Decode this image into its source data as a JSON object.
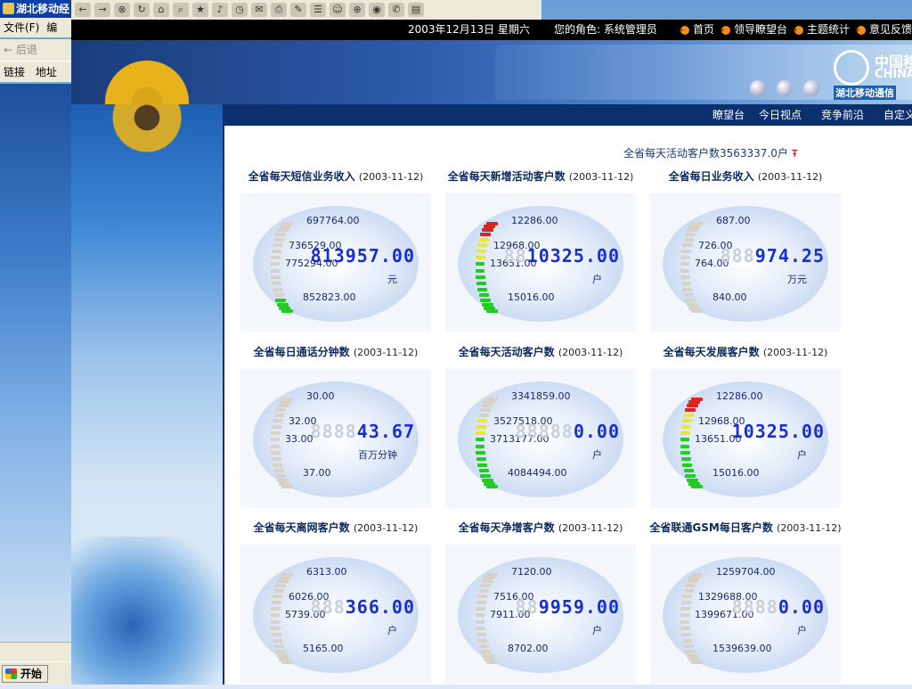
{
  "window": {
    "title": "湖北移动经",
    "menu": [
      "文件(F)",
      "编"
    ],
    "back_label": "后退",
    "links_label": "链接",
    "address_label": "地址",
    "start_label": "开始"
  },
  "banner": {
    "date": "2003年12月13日  星期六",
    "role": "您的角色: 系统管理员",
    "nav": [
      "首页",
      "领导瞭望台",
      "主题统计",
      "意见反馈"
    ],
    "logo_cn": "中国移",
    "logo_en": "CHINA",
    "logo_sub": "湖北移动通信"
  },
  "content": {
    "nav": [
      "瞭望台",
      "今日视点",
      "竞争前沿",
      "自定义"
    ],
    "active_count": "全省每天活动客户数3563337.0户"
  },
  "panels": [
    {
      "title": "全省每天短信业务收入",
      "date": "(2003-11-12)",
      "labels": [
        "697764.00",
        "736529.00",
        "775294.00",
        "852823.00"
      ],
      "value": "813957.00",
      "ghost": "",
      "unit": "元",
      "color_level": "green"
    },
    {
      "title": "全省每天新增活动客户数",
      "date": "(2003-11-12)",
      "labels": [
        "12286.00",
        "12968.00",
        "13651.00",
        "15016.00"
      ],
      "value": "10325.00",
      "ghost": "88",
      "unit": "户",
      "color_level": "full"
    },
    {
      "title": "全省每日业务收入",
      "date": "(2003-11-12)",
      "labels": [
        "687.00",
        "726.00",
        "764.00",
        "840.00"
      ],
      "value": "974.25",
      "ghost": "888",
      "unit": "万元",
      "color_level": "none"
    },
    {
      "title": "全省每日通话分钟数",
      "date": "(2003-11-12)",
      "labels": [
        "30.00",
        "32.00",
        "33.00",
        "37.00"
      ],
      "value": "43.67",
      "ghost": "8888",
      "unit": "百万分钟",
      "color_level": "none"
    },
    {
      "title": "全省每天活动客户数",
      "date": "(2003-11-12)",
      "labels": [
        "3341859.00",
        "3527518.00",
        "3713177.00",
        "4084494.00"
      ],
      "value": "0.00",
      "ghost": "88888",
      "unit": "户",
      "color_level": "yellow"
    },
    {
      "title": "全省每天发展客户数",
      "date": "(2003-11-12)",
      "labels": [
        "12286.00",
        "12968.00",
        "13651.00",
        "15016.00"
      ],
      "value": "10325.00",
      "ghost": "",
      "unit": "户",
      "color_level": "full"
    },
    {
      "title": "全省每天离网客户数",
      "date": "(2003-11-12)",
      "labels": [
        "6313.00",
        "6026.00",
        "5739.00",
        "5165.00"
      ],
      "value": "366.00",
      "ghost": "888",
      "unit": "户",
      "color_level": "none"
    },
    {
      "title": "全省每天净增客户数",
      "date": "(2003-11-12)",
      "labels": [
        "7120.00",
        "7516.00",
        "7911.00",
        "8702.00"
      ],
      "value": "9959.00",
      "ghost": "88",
      "unit": "户",
      "color_level": "none"
    },
    {
      "title": "全省联通GSM每日客户数",
      "date": "(2003-11-12)",
      "labels": [
        "1259704.00",
        "1329688.00",
        "1399671.00",
        "1539639.00"
      ],
      "value": "0.00",
      "ghost": "8888",
      "unit": "户",
      "color_level": "none"
    }
  ],
  "colors": {
    "led": "#1a2fcf",
    "green": "#22cc22",
    "yellow": "#e8e63a",
    "red": "#dd2222",
    "grey": "#d6d2c8",
    "nav_bg": "#0c2f6e"
  }
}
